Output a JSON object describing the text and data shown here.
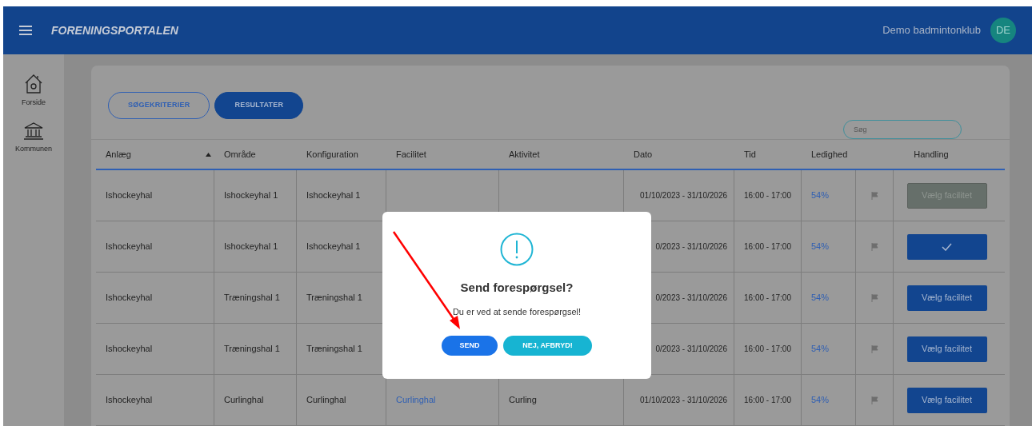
{
  "header": {
    "title": "FORENINGSPORTALEN",
    "club": "Demo badmintonklub",
    "avatar": "DE"
  },
  "sidebar": {
    "items": [
      {
        "kind": "home",
        "label": "Forside"
      },
      {
        "kind": "municipality",
        "label": "Kommunen"
      }
    ]
  },
  "tabs": [
    {
      "label": "SØGEKRITERIER",
      "selected": false
    },
    {
      "label": "RESULTATER",
      "selected": true
    }
  ],
  "search": {
    "placeholder": "Søg"
  },
  "table": {
    "columns": [
      {
        "label": "Anlæg",
        "sorted": true
      },
      {
        "label": "Område",
        "sorted": false
      },
      {
        "label": "Konfiguration",
        "sorted": false
      },
      {
        "label": "Facilitet",
        "sorted": false
      },
      {
        "label": "Aktivitet",
        "sorted": false
      },
      {
        "label": "Dato",
        "sorted": false
      },
      {
        "label": "Tid",
        "sorted": false
      },
      {
        "label": "Ledighed",
        "sorted": false
      },
      {
        "label": "Handling",
        "sorted": false
      }
    ],
    "rows": [
      {
        "anlaeg": "Ishockeyhal",
        "omraade": "Ishockeyhal 1",
        "konfiguration": "Ishockeyhal 1",
        "dato": "01/10/2023 - 31/10/2026",
        "tid": "16:00 - 17:00",
        "ledighed": "54%",
        "action": {
          "kind": "disabled",
          "label": "Vælg facilitet"
        }
      },
      {
        "anlaeg": "Ishockeyhal",
        "omraade": "Ishockeyhal 1",
        "konfiguration": "Ishockeyhal 1",
        "dato": "0/2023 - 31/10/2026",
        "tid": "16:00 - 17:00",
        "ledighed": "54%",
        "action": {
          "kind": "chosen"
        }
      },
      {
        "anlaeg": "Ishockeyhal",
        "omraade": "Træningshal 1",
        "konfiguration": "Træningshal 1",
        "dato": "0/2023 - 31/10/2026",
        "tid": "16:00 - 17:00",
        "ledighed": "54%",
        "action": {
          "kind": "select",
          "label": "Vælg facilitet"
        }
      },
      {
        "anlaeg": "Ishockeyhal",
        "omraade": "Træningshal 1",
        "konfiguration": "Træningshal 1",
        "dato": "0/2023 - 31/10/2026",
        "tid": "16:00 - 17:00",
        "ledighed": "54%",
        "action": {
          "kind": "select",
          "label": "Vælg facilitet"
        }
      },
      {
        "anlaeg": "Ishockeyhal",
        "omraade": "Curlinghal",
        "konfiguration": "Curlinghal",
        "facilitet": "Curlinghal",
        "aktivitet": "Curling",
        "dato": "01/10/2023 - 31/10/2026",
        "tid": "16:00 - 17:00",
        "ledighed": "54%",
        "action": {
          "kind": "select",
          "label": "Vælg facilitet"
        }
      }
    ]
  },
  "dialog": {
    "title": "Send forespørgsel?",
    "message": "Du er ved at sende forespørgsel!",
    "buttons": [
      {
        "kind": "confirm",
        "label": "SEND"
      },
      {
        "kind": "cancel",
        "label": "NEJ, AFBRYD!"
      }
    ]
  }
}
